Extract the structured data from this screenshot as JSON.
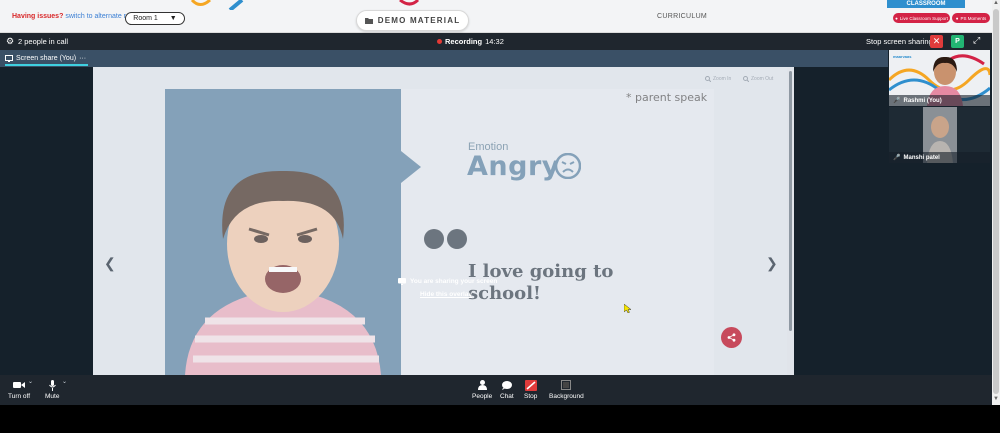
{
  "topbar": {
    "issues_text": "Having issues?",
    "alt_room_link": "switch to alternate room",
    "room_select_value": "Room 1",
    "demo_material_label": "DEMO MATERIAL",
    "curriculum_label": "CURRICULUM",
    "classroom_tag": "CLASSROOM",
    "live_support_label": "Live Classroom Support",
    "ps_moments_label": "PS Moments"
  },
  "callbar": {
    "people_in_call": "2 people in call",
    "recording_label": "Recording",
    "recording_time": "14:32",
    "stop_sharing_label": "Stop screen sharing",
    "participant_badge": "P"
  },
  "sharetab": {
    "label": "Screen share (You)",
    "menu": "···"
  },
  "slide": {
    "zoom_in": "Zoom In",
    "zoom_out": "Zoom Out",
    "note": "* parent speak",
    "emotion_label": "Emotion",
    "emotion_value": "Angry",
    "sentence": "I love going to school!"
  },
  "overlay": {
    "sharing_message": "You are sharing your screen",
    "hide_link": "Hide this overlay"
  },
  "tiles": [
    {
      "name": "Rashmi (You)",
      "brand": "maarvaas"
    },
    {
      "name": "Manshi patel"
    }
  ],
  "controls": {
    "turn_off": "Turn off",
    "mute": "Mute",
    "people": "People",
    "chat": "Chat",
    "stop": "Stop",
    "background": "Background"
  },
  "colors": {
    "accent_red": "#d32346",
    "slide_blue": "#4f7a9b",
    "call_bg": "#1f262e",
    "badge_green": "#22b573"
  },
  "icons": [
    "folder-icon",
    "gear-icon",
    "close-icon",
    "expand-icon",
    "screen-share-icon",
    "zoom-in-icon",
    "zoom-out-icon",
    "angry-face-icon",
    "share-icon",
    "chevron-left-icon",
    "chevron-right-icon",
    "mic-icon",
    "camera-icon",
    "person-icon",
    "chat-bubble-icon",
    "stop-share-icon",
    "background-icon"
  ]
}
